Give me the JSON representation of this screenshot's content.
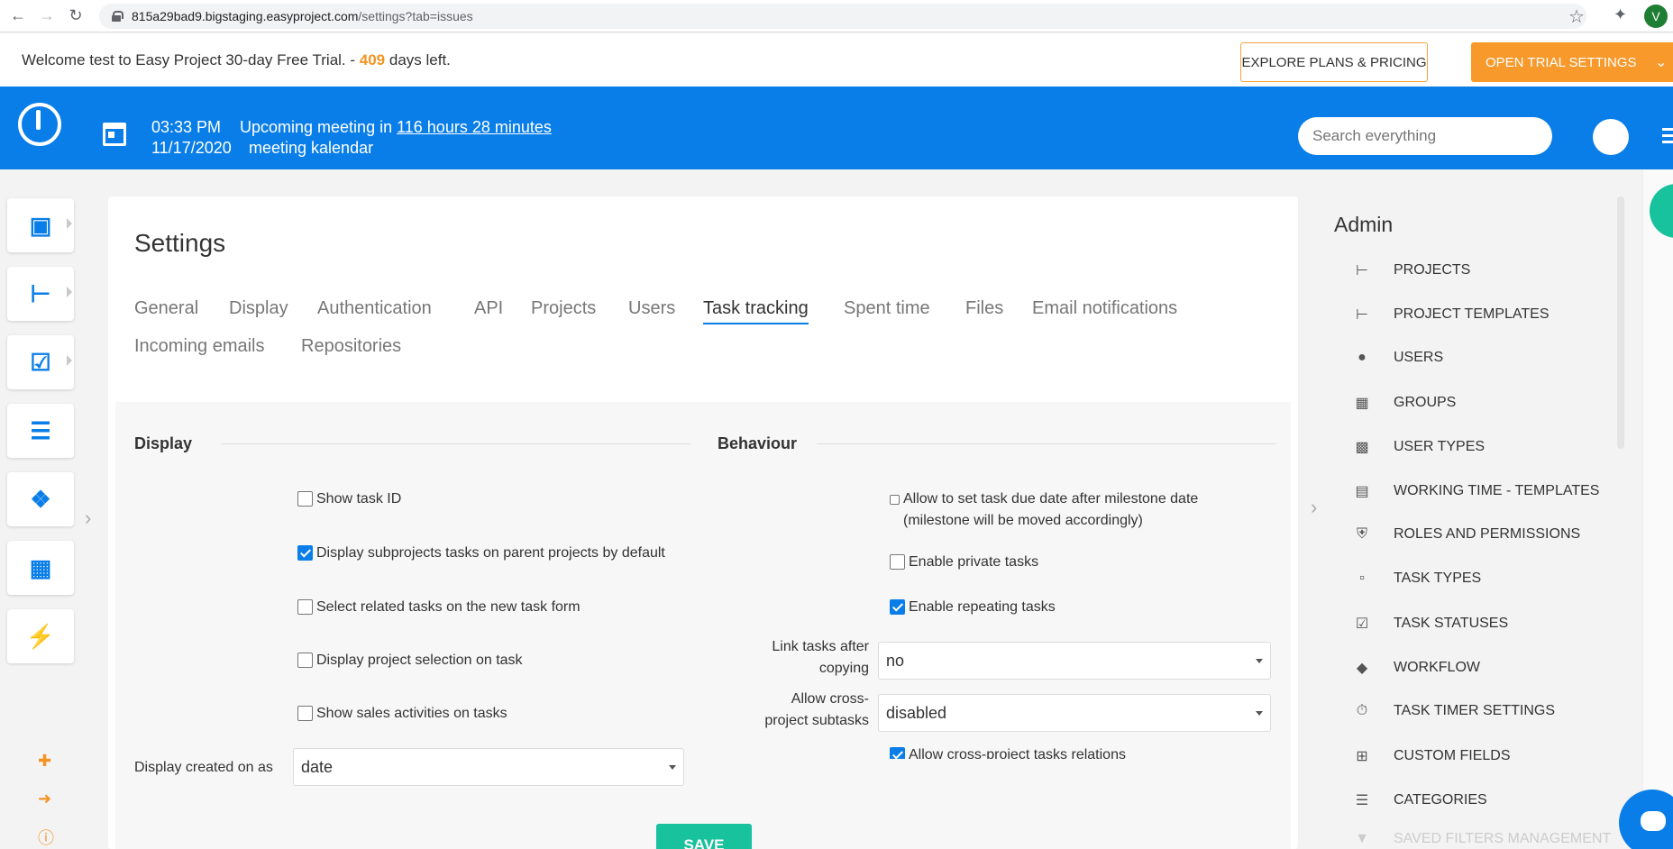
{
  "browser": {
    "url_host": "815a29bad9.bigstaging.easyproject.com",
    "url_path": "/settings?tab=issues",
    "profile_initial": "V"
  },
  "trial": {
    "welcome_prefix": "Welcome test to Easy Project 30-day Free Trial. - ",
    "days": "409",
    "welcome_suffix": " days left.",
    "explore_label": "EXPLORE PLANS & PRICING",
    "settings_label": "OPEN TRIAL SETTINGS"
  },
  "header": {
    "time": "03:33 PM",
    "date": "11/17/2020",
    "meeting_prefix": "Upcoming meeting in ",
    "meeting_link": "116 hours 28 minutes",
    "meeting_name": "meeting kalendar",
    "search_placeholder": "Search everything"
  },
  "settings": {
    "title": "Settings",
    "tabs": [
      {
        "label": "General"
      },
      {
        "label": "Display"
      },
      {
        "label": "Authentication"
      },
      {
        "label": "API"
      },
      {
        "label": "Projects"
      },
      {
        "label": "Users"
      },
      {
        "label": "Task tracking",
        "active": true
      },
      {
        "label": "Spent time"
      },
      {
        "label": "Files"
      },
      {
        "label": "Email notifications"
      },
      {
        "label": "Incoming emails"
      },
      {
        "label": "Repositories"
      }
    ],
    "display": {
      "title": "Display",
      "checkboxes": [
        {
          "label": "Show task ID",
          "checked": false
        },
        {
          "label": "Display subprojects tasks on parent projects by default",
          "checked": true
        },
        {
          "label": "Select related tasks on the new task form",
          "checked": false
        },
        {
          "label": "Display project selection on task",
          "checked": false
        },
        {
          "label": "Show sales activities on tasks",
          "checked": false
        }
      ],
      "created_on_label": "Display created on as",
      "created_on_value": "date"
    },
    "behaviour": {
      "title": "Behaviour",
      "checkboxes": [
        {
          "label": "Allow to set task due date after milestone date (milestone will be moved accordingly)",
          "checked": false
        },
        {
          "label": "Enable private tasks",
          "checked": false
        },
        {
          "label": "Enable repeating tasks",
          "checked": true
        }
      ],
      "link_label": "Link tasks after copying",
      "link_value": "no",
      "cross_label": "Allow cross-project subtasks",
      "cross_value": "disabled",
      "partial_label": "Allow cross-project tasks relations"
    },
    "save_label": "SAVE"
  },
  "admin": {
    "title": "Admin",
    "items": [
      {
        "label": "PROJECTS",
        "icon": "project-tree-icon"
      },
      {
        "label": "PROJECT TEMPLATES",
        "icon": "template-tree-icon"
      },
      {
        "label": "USERS",
        "icon": "user-icon"
      },
      {
        "label": "GROUPS",
        "icon": "groups-icon"
      },
      {
        "label": "USER TYPES",
        "icon": "badge-icon"
      },
      {
        "label": "WORKING TIME - TEMPLATES",
        "icon": "calendar-icon"
      },
      {
        "label": "ROLES AND PERMISSIONS",
        "icon": "shield-icon"
      },
      {
        "label": "TASK TYPES",
        "icon": "clipboard-icon"
      },
      {
        "label": "TASK STATUSES",
        "icon": "clipboard-check-icon"
      },
      {
        "label": "WORKFLOW",
        "icon": "diamond-icon"
      },
      {
        "label": "TASK TIMER SETTINGS",
        "icon": "stopwatch-icon"
      },
      {
        "label": "CUSTOM FIELDS",
        "icon": "plus-square-icon"
      },
      {
        "label": "CATEGORIES",
        "icon": "list-icon"
      },
      {
        "label": "SAVED FILTERS MANAGEMENT",
        "icon": "filter-icon"
      }
    ]
  },
  "colors": {
    "brand_blue": "#0a7ee8",
    "accent_orange": "#f7992b",
    "save_green": "#18c29c"
  }
}
